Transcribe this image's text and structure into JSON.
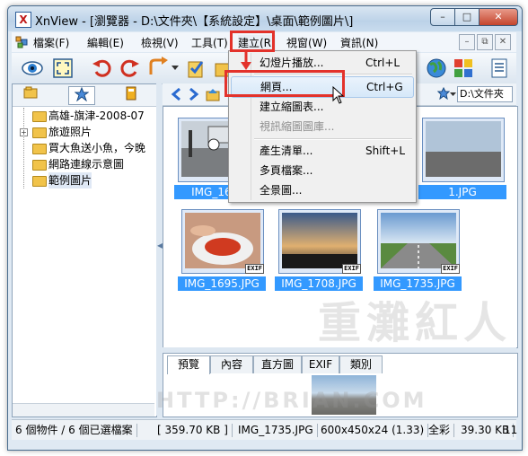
{
  "window": {
    "app_icon_letter": "X",
    "title": "XnView - [瀏覽器 - D:\\文件夾\\【系統設定】\\桌面\\範例圖片\\]",
    "controls": {
      "minimize": "–",
      "maximize": "□",
      "close": "✕"
    }
  },
  "menubar": {
    "items": [
      {
        "label": "檔案(F)"
      },
      {
        "label": "編輯(E)"
      },
      {
        "label": "檢視(V)"
      },
      {
        "label": "工具(T)"
      },
      {
        "label": "建立(R)"
      },
      {
        "label": "視窗(W)"
      },
      {
        "label": "資訊(N)"
      }
    ],
    "mdi_controls": {
      "minimize": "–",
      "restore": "⧉",
      "close": "✕"
    }
  },
  "left_panel": {
    "tabs": [
      {
        "icon": "folder-tree-icon"
      },
      {
        "icon": "favorites-star-icon"
      },
      {
        "icon": "catalog-icon"
      }
    ],
    "tree": [
      {
        "label": "高雄-旗津-2008-07",
        "expandable": false
      },
      {
        "label": "旅遊照片",
        "expandable": true,
        "expander": "+"
      },
      {
        "label": "買大魚送小魚，今晚",
        "expandable": false
      },
      {
        "label": "網路連線示意圖",
        "expandable": false
      },
      {
        "label": "範例圖片",
        "expandable": false,
        "selected": true
      }
    ]
  },
  "navbar": {
    "path": "D:\\文件夾"
  },
  "thumbnails": [
    {
      "name": "IMG_1658",
      "scene": "station"
    },
    {
      "name": "1.JPG",
      "scene": "street"
    },
    {
      "name": "IMG_1695.JPG",
      "scene": "food",
      "badge": "EXIF"
    },
    {
      "name": "IMG_1708.JPG",
      "scene": "sunset",
      "badge": "EXIF"
    },
    {
      "name": "IMG_1735.JPG",
      "scene": "road",
      "badge": "EXIF"
    }
  ],
  "preview": {
    "tabs": [
      {
        "label": "預覽",
        "selected": true
      },
      {
        "label": "內容"
      },
      {
        "label": "直方圖"
      },
      {
        "label": "EXIF"
      },
      {
        "label": "類別"
      }
    ]
  },
  "context_menu": {
    "items": [
      {
        "label": "幻燈片播放...",
        "shortcut": "Ctrl+L",
        "disabled": false
      },
      {
        "label": "網頁...",
        "shortcut": "Ctrl+G",
        "disabled": false,
        "highlighted": true
      },
      {
        "label": "建立縮圖表...",
        "shortcut": "",
        "disabled": false
      },
      {
        "label": "視訊縮圖圖庫...",
        "shortcut": "",
        "disabled": true
      },
      {
        "label": "產生清單...",
        "shortcut": "Shift+L",
        "disabled": false
      },
      {
        "label": "多頁檔案...",
        "shortcut": "",
        "disabled": false
      },
      {
        "label": "全景圖...",
        "shortcut": "",
        "disabled": false
      }
    ]
  },
  "statusbar": {
    "selection": "6 個物件 / 6 個已選檔案",
    "size": "[ 359.70 KB ]",
    "filename": "IMG_1735.JPG",
    "dimensions": "600x450x24 (1.33)",
    "color_mode": "全彩",
    "file_size": "39.30 KB",
    "count": "11"
  },
  "watermark": {
    "text": "重灘紅人",
    "url": "HTTP://BRIAN.COM"
  },
  "colors": {
    "highlight_red": "#e3322b",
    "selection_blue": "#3399ff"
  }
}
